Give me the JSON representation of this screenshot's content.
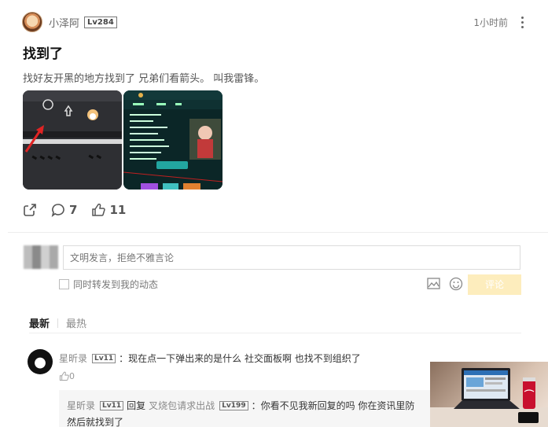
{
  "post": {
    "username": "小泽阿",
    "level": "Lv284",
    "time": "1小时前",
    "title": "找到了",
    "body": "找好友开黑的地方找到了 兄弟们看箭头。 叫我雷锋。",
    "comments_count": "7",
    "likes_count": "11"
  },
  "comment_box": {
    "placeholder": "文明发言，拒绝不雅言论",
    "repost_label": "同时转发到我的动态",
    "submit_label": "评论"
  },
  "tabs": {
    "latest": "最新",
    "hottest": "最热"
  },
  "comments": [
    {
      "name": "星昕录",
      "level": "Lv11",
      "text": "：现在点一下弹出来的是什么 社交面板啊 也找不到组织了",
      "likes": "0",
      "reply": {
        "name": "星昕录",
        "level": "Lv11",
        "verb": "回复",
        "target": "叉烧包请求出战",
        "target_level": "Lv199",
        "text_line1": "：你看不见我新回复的吗 你在资讯里防",
        "text_line2": "然后就找到了"
      }
    }
  ],
  "colors": {
    "accent": "#fdedbd",
    "text": "#222222",
    "muted": "#888888"
  }
}
